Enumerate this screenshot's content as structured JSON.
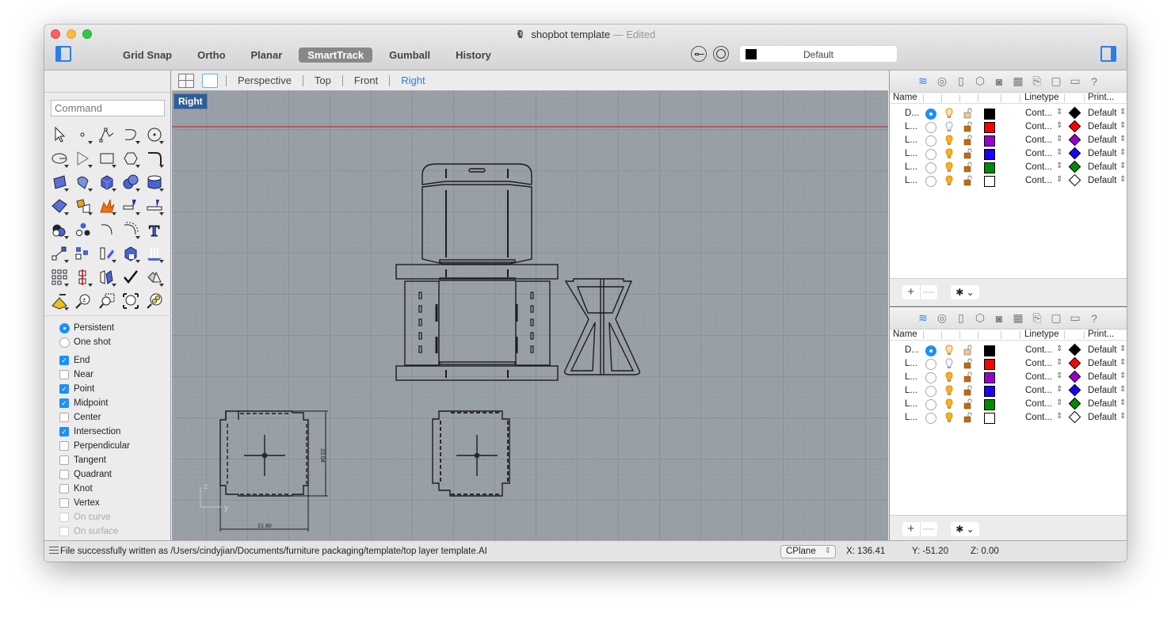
{
  "window": {
    "title": "shopbot template",
    "title_suffix": "— Edited"
  },
  "toolbar": {
    "modes": [
      {
        "label": "Grid Snap",
        "active": false
      },
      {
        "label": "Ortho",
        "active": false
      },
      {
        "label": "Planar",
        "active": false
      },
      {
        "label": "SmartTrack",
        "active": true
      },
      {
        "label": "Gumball",
        "active": false
      },
      {
        "label": "History",
        "active": false
      }
    ],
    "current_layer": "Default",
    "current_layer_color": "#000000"
  },
  "left_panel": {
    "command_placeholder": "Command",
    "tools": [
      "select-arrow",
      "point",
      "polyline",
      "curve",
      "circle",
      "ellipse",
      "polygon-curve",
      "rectangle",
      "polygon",
      "fillet",
      "surface-from-points",
      "surface-edge",
      "box",
      "sphere",
      "cylinder",
      "surface-patch",
      "boolean-puzzle",
      "explode",
      "trim",
      "split",
      "boolean-union",
      "group-objects",
      "curve-arc",
      "offset-curve",
      "text",
      "transform-move",
      "array",
      "rotate",
      "extrude-solid",
      "project",
      "grid-array",
      "mirror",
      "flip",
      "check",
      "solid-cone",
      "analyze",
      "zoom-in-out",
      "zoom-window",
      "zoom-extents",
      "zoom-selected"
    ],
    "snap_modes": [
      {
        "label": "Persistent",
        "selected": true
      },
      {
        "label": "One shot",
        "selected": false
      }
    ],
    "osnaps": [
      {
        "label": "End",
        "checked": true,
        "enabled": true
      },
      {
        "label": "Near",
        "checked": false,
        "enabled": true
      },
      {
        "label": "Point",
        "checked": true,
        "enabled": true
      },
      {
        "label": "Midpoint",
        "checked": true,
        "enabled": true
      },
      {
        "label": "Center",
        "checked": false,
        "enabled": true
      },
      {
        "label": "Intersection",
        "checked": true,
        "enabled": true
      },
      {
        "label": "Perpendicular",
        "checked": false,
        "enabled": true
      },
      {
        "label": "Tangent",
        "checked": false,
        "enabled": true
      },
      {
        "label": "Quadrant",
        "checked": false,
        "enabled": true
      },
      {
        "label": "Knot",
        "checked": false,
        "enabled": true
      },
      {
        "label": "Vertex",
        "checked": false,
        "enabled": true
      },
      {
        "label": "On curve",
        "checked": false,
        "enabled": false
      },
      {
        "label": "On surface",
        "checked": false,
        "enabled": false
      }
    ]
  },
  "viewport": {
    "tabs": [
      {
        "label": "Perspective",
        "active": false
      },
      {
        "label": "Top",
        "active": false
      },
      {
        "label": "Front",
        "active": false
      },
      {
        "label": "Right",
        "active": true
      }
    ],
    "active_label": "Right",
    "dimension_width": "21.80",
    "dimension_height": "23.04",
    "axis_z": "z",
    "axis_y": "y"
  },
  "layers_panels": [
    {
      "headers": {
        "name": "Name",
        "linetype": "Linetype",
        "print": "Print..."
      },
      "rows": [
        {
          "name": "D...",
          "current": true,
          "bulb": "dim",
          "color": "#000000",
          "linetype": "Cont...",
          "print": "Default"
        },
        {
          "name": "L...",
          "current": false,
          "bulb": "off",
          "color": "#ff0000",
          "linetype": "Cont...",
          "print": "Default"
        },
        {
          "name": "L...",
          "current": false,
          "bulb": "on",
          "color": "#9900cc",
          "linetype": "Cont...",
          "print": "Default"
        },
        {
          "name": "L...",
          "current": false,
          "bulb": "on",
          "color": "#1a00ff",
          "linetype": "Cont...",
          "print": "Default"
        },
        {
          "name": "L...",
          "current": false,
          "bulb": "on",
          "color": "#008a00",
          "linetype": "Cont...",
          "print": "Default"
        },
        {
          "name": "L...",
          "current": false,
          "bulb": "on",
          "color": "#ffffff",
          "linetype": "Cont...",
          "print": "Default"
        }
      ]
    },
    {
      "headers": {
        "name": "Name",
        "linetype": "Linetype",
        "print": "Print..."
      },
      "rows": [
        {
          "name": "D...",
          "current": true,
          "bulb": "dim",
          "color": "#000000",
          "linetype": "Cont...",
          "print": "Default"
        },
        {
          "name": "L...",
          "current": false,
          "bulb": "off",
          "color": "#ff0000",
          "linetype": "Cont...",
          "print": "Default"
        },
        {
          "name": "L...",
          "current": false,
          "bulb": "on",
          "color": "#9900cc",
          "linetype": "Cont...",
          "print": "Default"
        },
        {
          "name": "L...",
          "current": false,
          "bulb": "on",
          "color": "#1a00ff",
          "linetype": "Cont...",
          "print": "Default"
        },
        {
          "name": "L...",
          "current": false,
          "bulb": "on",
          "color": "#008a00",
          "linetype": "Cont...",
          "print": "Default"
        },
        {
          "name": "L...",
          "current": false,
          "bulb": "on",
          "color": "#ffffff",
          "linetype": "Cont...",
          "print": "Default"
        }
      ]
    }
  ],
  "panel_footer": {
    "add": "+",
    "remove": "—",
    "gear": "✱ ⌄"
  },
  "status": {
    "message": "File successfully written as /Users/cindyjian/Documents/furniture packaging/template/top layer template.AI",
    "cplane": "CPlane",
    "x": "X: 136.41",
    "y": "Y: -51.20",
    "z": "Z: 0.00"
  }
}
